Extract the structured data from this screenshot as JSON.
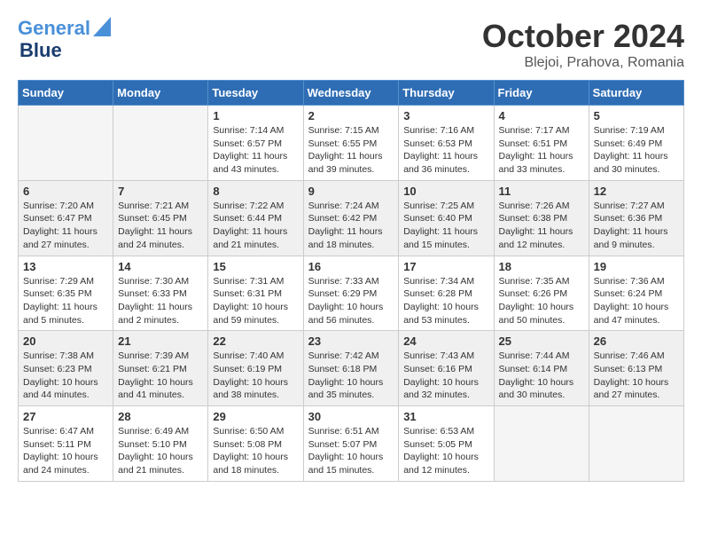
{
  "header": {
    "logo_line1": "General",
    "logo_line2": "Blue",
    "month_title": "October 2024",
    "location": "Blejoi, Prahova, Romania"
  },
  "days_of_week": [
    "Sunday",
    "Monday",
    "Tuesday",
    "Wednesday",
    "Thursday",
    "Friday",
    "Saturday"
  ],
  "weeks": [
    [
      {
        "day": "",
        "info": ""
      },
      {
        "day": "",
        "info": ""
      },
      {
        "day": "1",
        "info": "Sunrise: 7:14 AM\nSunset: 6:57 PM\nDaylight: 11 hours and 43 minutes."
      },
      {
        "day": "2",
        "info": "Sunrise: 7:15 AM\nSunset: 6:55 PM\nDaylight: 11 hours and 39 minutes."
      },
      {
        "day": "3",
        "info": "Sunrise: 7:16 AM\nSunset: 6:53 PM\nDaylight: 11 hours and 36 minutes."
      },
      {
        "day": "4",
        "info": "Sunrise: 7:17 AM\nSunset: 6:51 PM\nDaylight: 11 hours and 33 minutes."
      },
      {
        "day": "5",
        "info": "Sunrise: 7:19 AM\nSunset: 6:49 PM\nDaylight: 11 hours and 30 minutes."
      }
    ],
    [
      {
        "day": "6",
        "info": "Sunrise: 7:20 AM\nSunset: 6:47 PM\nDaylight: 11 hours and 27 minutes."
      },
      {
        "day": "7",
        "info": "Sunrise: 7:21 AM\nSunset: 6:45 PM\nDaylight: 11 hours and 24 minutes."
      },
      {
        "day": "8",
        "info": "Sunrise: 7:22 AM\nSunset: 6:44 PM\nDaylight: 11 hours and 21 minutes."
      },
      {
        "day": "9",
        "info": "Sunrise: 7:24 AM\nSunset: 6:42 PM\nDaylight: 11 hours and 18 minutes."
      },
      {
        "day": "10",
        "info": "Sunrise: 7:25 AM\nSunset: 6:40 PM\nDaylight: 11 hours and 15 minutes."
      },
      {
        "day": "11",
        "info": "Sunrise: 7:26 AM\nSunset: 6:38 PM\nDaylight: 11 hours and 12 minutes."
      },
      {
        "day": "12",
        "info": "Sunrise: 7:27 AM\nSunset: 6:36 PM\nDaylight: 11 hours and 9 minutes."
      }
    ],
    [
      {
        "day": "13",
        "info": "Sunrise: 7:29 AM\nSunset: 6:35 PM\nDaylight: 11 hours and 5 minutes."
      },
      {
        "day": "14",
        "info": "Sunrise: 7:30 AM\nSunset: 6:33 PM\nDaylight: 11 hours and 2 minutes."
      },
      {
        "day": "15",
        "info": "Sunrise: 7:31 AM\nSunset: 6:31 PM\nDaylight: 10 hours and 59 minutes."
      },
      {
        "day": "16",
        "info": "Sunrise: 7:33 AM\nSunset: 6:29 PM\nDaylight: 10 hours and 56 minutes."
      },
      {
        "day": "17",
        "info": "Sunrise: 7:34 AM\nSunset: 6:28 PM\nDaylight: 10 hours and 53 minutes."
      },
      {
        "day": "18",
        "info": "Sunrise: 7:35 AM\nSunset: 6:26 PM\nDaylight: 10 hours and 50 minutes."
      },
      {
        "day": "19",
        "info": "Sunrise: 7:36 AM\nSunset: 6:24 PM\nDaylight: 10 hours and 47 minutes."
      }
    ],
    [
      {
        "day": "20",
        "info": "Sunrise: 7:38 AM\nSunset: 6:23 PM\nDaylight: 10 hours and 44 minutes."
      },
      {
        "day": "21",
        "info": "Sunrise: 7:39 AM\nSunset: 6:21 PM\nDaylight: 10 hours and 41 minutes."
      },
      {
        "day": "22",
        "info": "Sunrise: 7:40 AM\nSunset: 6:19 PM\nDaylight: 10 hours and 38 minutes."
      },
      {
        "day": "23",
        "info": "Sunrise: 7:42 AM\nSunset: 6:18 PM\nDaylight: 10 hours and 35 minutes."
      },
      {
        "day": "24",
        "info": "Sunrise: 7:43 AM\nSunset: 6:16 PM\nDaylight: 10 hours and 32 minutes."
      },
      {
        "day": "25",
        "info": "Sunrise: 7:44 AM\nSunset: 6:14 PM\nDaylight: 10 hours and 30 minutes."
      },
      {
        "day": "26",
        "info": "Sunrise: 7:46 AM\nSunset: 6:13 PM\nDaylight: 10 hours and 27 minutes."
      }
    ],
    [
      {
        "day": "27",
        "info": "Sunrise: 6:47 AM\nSunset: 5:11 PM\nDaylight: 10 hours and 24 minutes."
      },
      {
        "day": "28",
        "info": "Sunrise: 6:49 AM\nSunset: 5:10 PM\nDaylight: 10 hours and 21 minutes."
      },
      {
        "day": "29",
        "info": "Sunrise: 6:50 AM\nSunset: 5:08 PM\nDaylight: 10 hours and 18 minutes."
      },
      {
        "day": "30",
        "info": "Sunrise: 6:51 AM\nSunset: 5:07 PM\nDaylight: 10 hours and 15 minutes."
      },
      {
        "day": "31",
        "info": "Sunrise: 6:53 AM\nSunset: 5:05 PM\nDaylight: 10 hours and 12 minutes."
      },
      {
        "day": "",
        "info": ""
      },
      {
        "day": "",
        "info": ""
      }
    ]
  ]
}
